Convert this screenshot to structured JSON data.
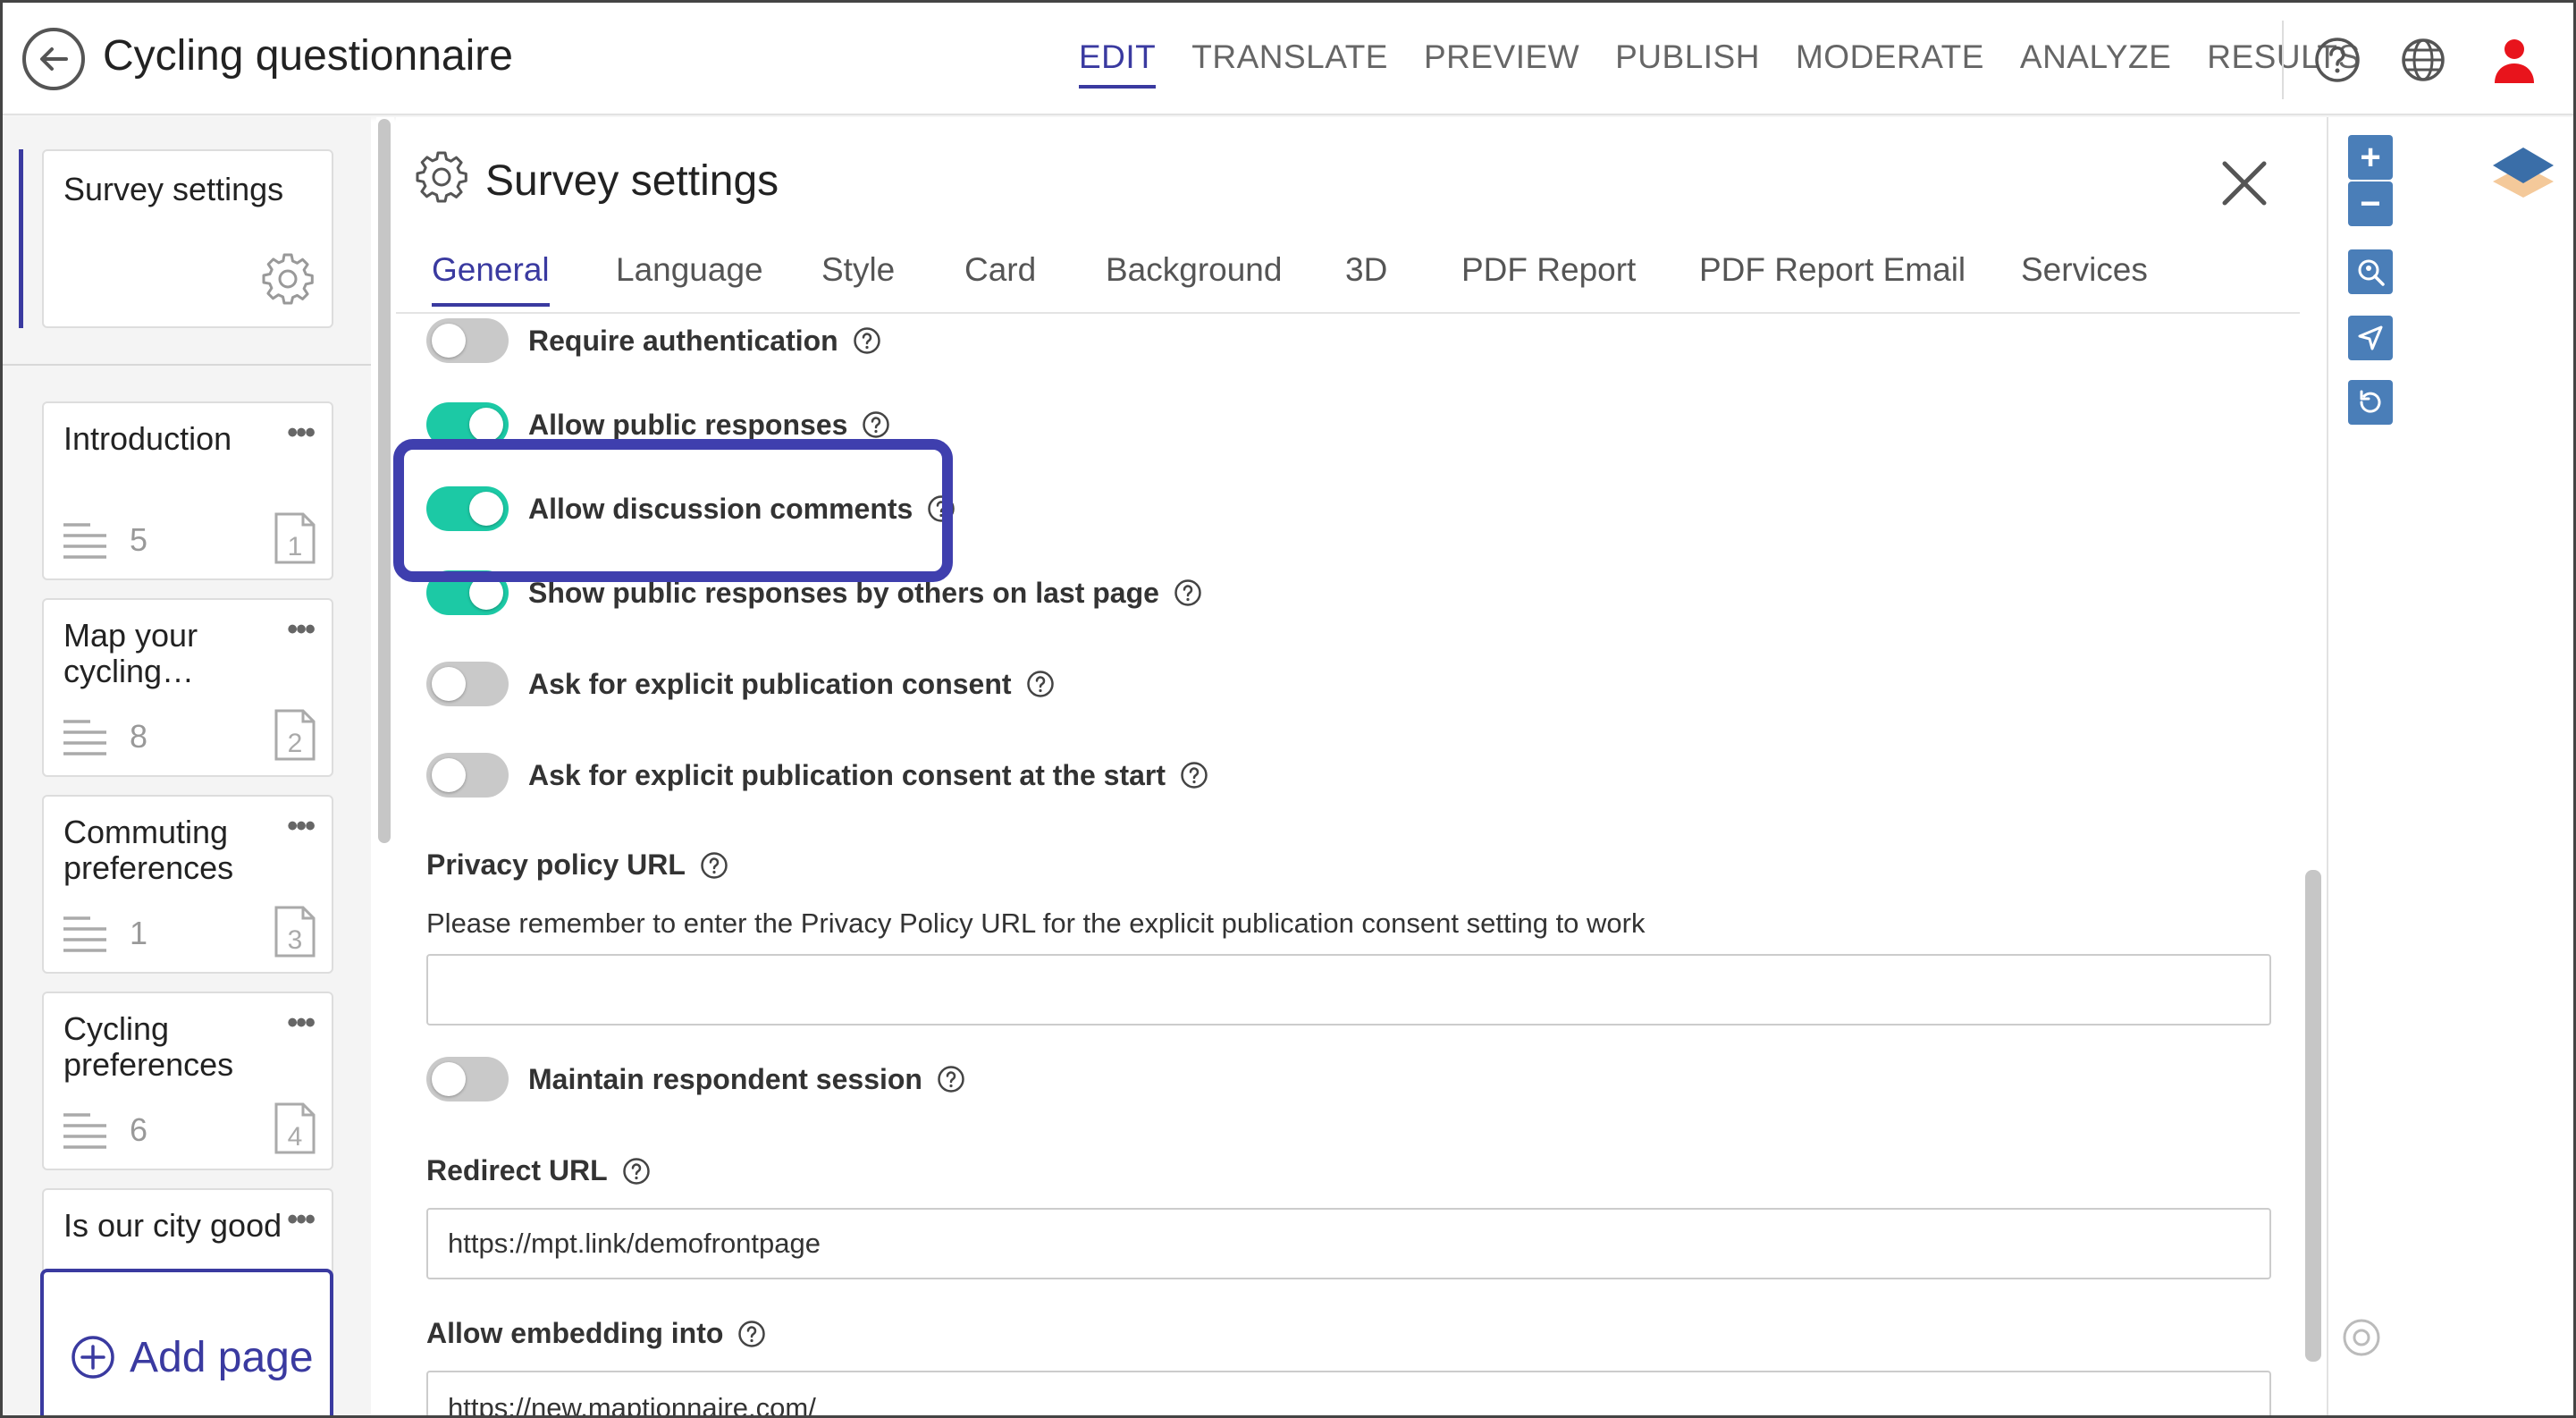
{
  "header": {
    "title": "Cycling questionnaire",
    "nav": [
      "EDIT",
      "TRANSLATE",
      "PREVIEW",
      "PUBLISH",
      "MODERATE",
      "ANALYZE",
      "RESULTS"
    ],
    "active_nav": "EDIT"
  },
  "sidebar": {
    "settings_label": "Survey settings",
    "pages": [
      {
        "title": "Introduction",
        "count": "5",
        "num": "1"
      },
      {
        "title": "Map your cycling…",
        "count": "8",
        "num": "2"
      },
      {
        "title": "Commuting preferences",
        "count": "1",
        "num": "3"
      },
      {
        "title": "Cycling preferences",
        "count": "6",
        "num": "4"
      },
      {
        "title": "Is our city good",
        "count": "",
        "num": ""
      }
    ],
    "add_page_label": "Add page"
  },
  "panel": {
    "title": "Survey settings",
    "tabs": [
      "General",
      "Language",
      "Style",
      "Card",
      "Background",
      "3D",
      "PDF Report",
      "PDF Report Email",
      "Services"
    ],
    "active_tab": "General",
    "toggles": [
      {
        "label": "Require authentication",
        "on": false
      },
      {
        "label": "Allow public responses",
        "on": true
      },
      {
        "label": "Allow discussion comments",
        "on": true
      },
      {
        "label": "Show public responses by others on last page",
        "on": true
      },
      {
        "label": "Ask for explicit publication consent",
        "on": false
      },
      {
        "label": "Ask for explicit publication consent at the start",
        "on": false
      }
    ],
    "privacy": {
      "label": "Privacy policy URL",
      "hint": "Please remember to enter the Privacy Policy URL for the explicit publication consent setting to work",
      "value": ""
    },
    "session_toggle": {
      "label": "Maintain respondent session",
      "on": false
    },
    "redirect": {
      "label": "Redirect URL",
      "value": "https://mpt.link/demofrontpage"
    },
    "embedding": {
      "label": "Allow embedding into",
      "value": "https://new.maptionnaire.com/"
    }
  },
  "colors": {
    "accent": "#3a3aa0",
    "toggle_on": "#1cc9a5",
    "toggle_off": "#c9c9c9",
    "map_button": "#4a7eb8",
    "avatar": "#e8141c"
  },
  "map_tools": [
    "zoom-in-icon",
    "zoom-out-icon",
    "locate-icon",
    "navigate-icon",
    "reset-icon"
  ]
}
